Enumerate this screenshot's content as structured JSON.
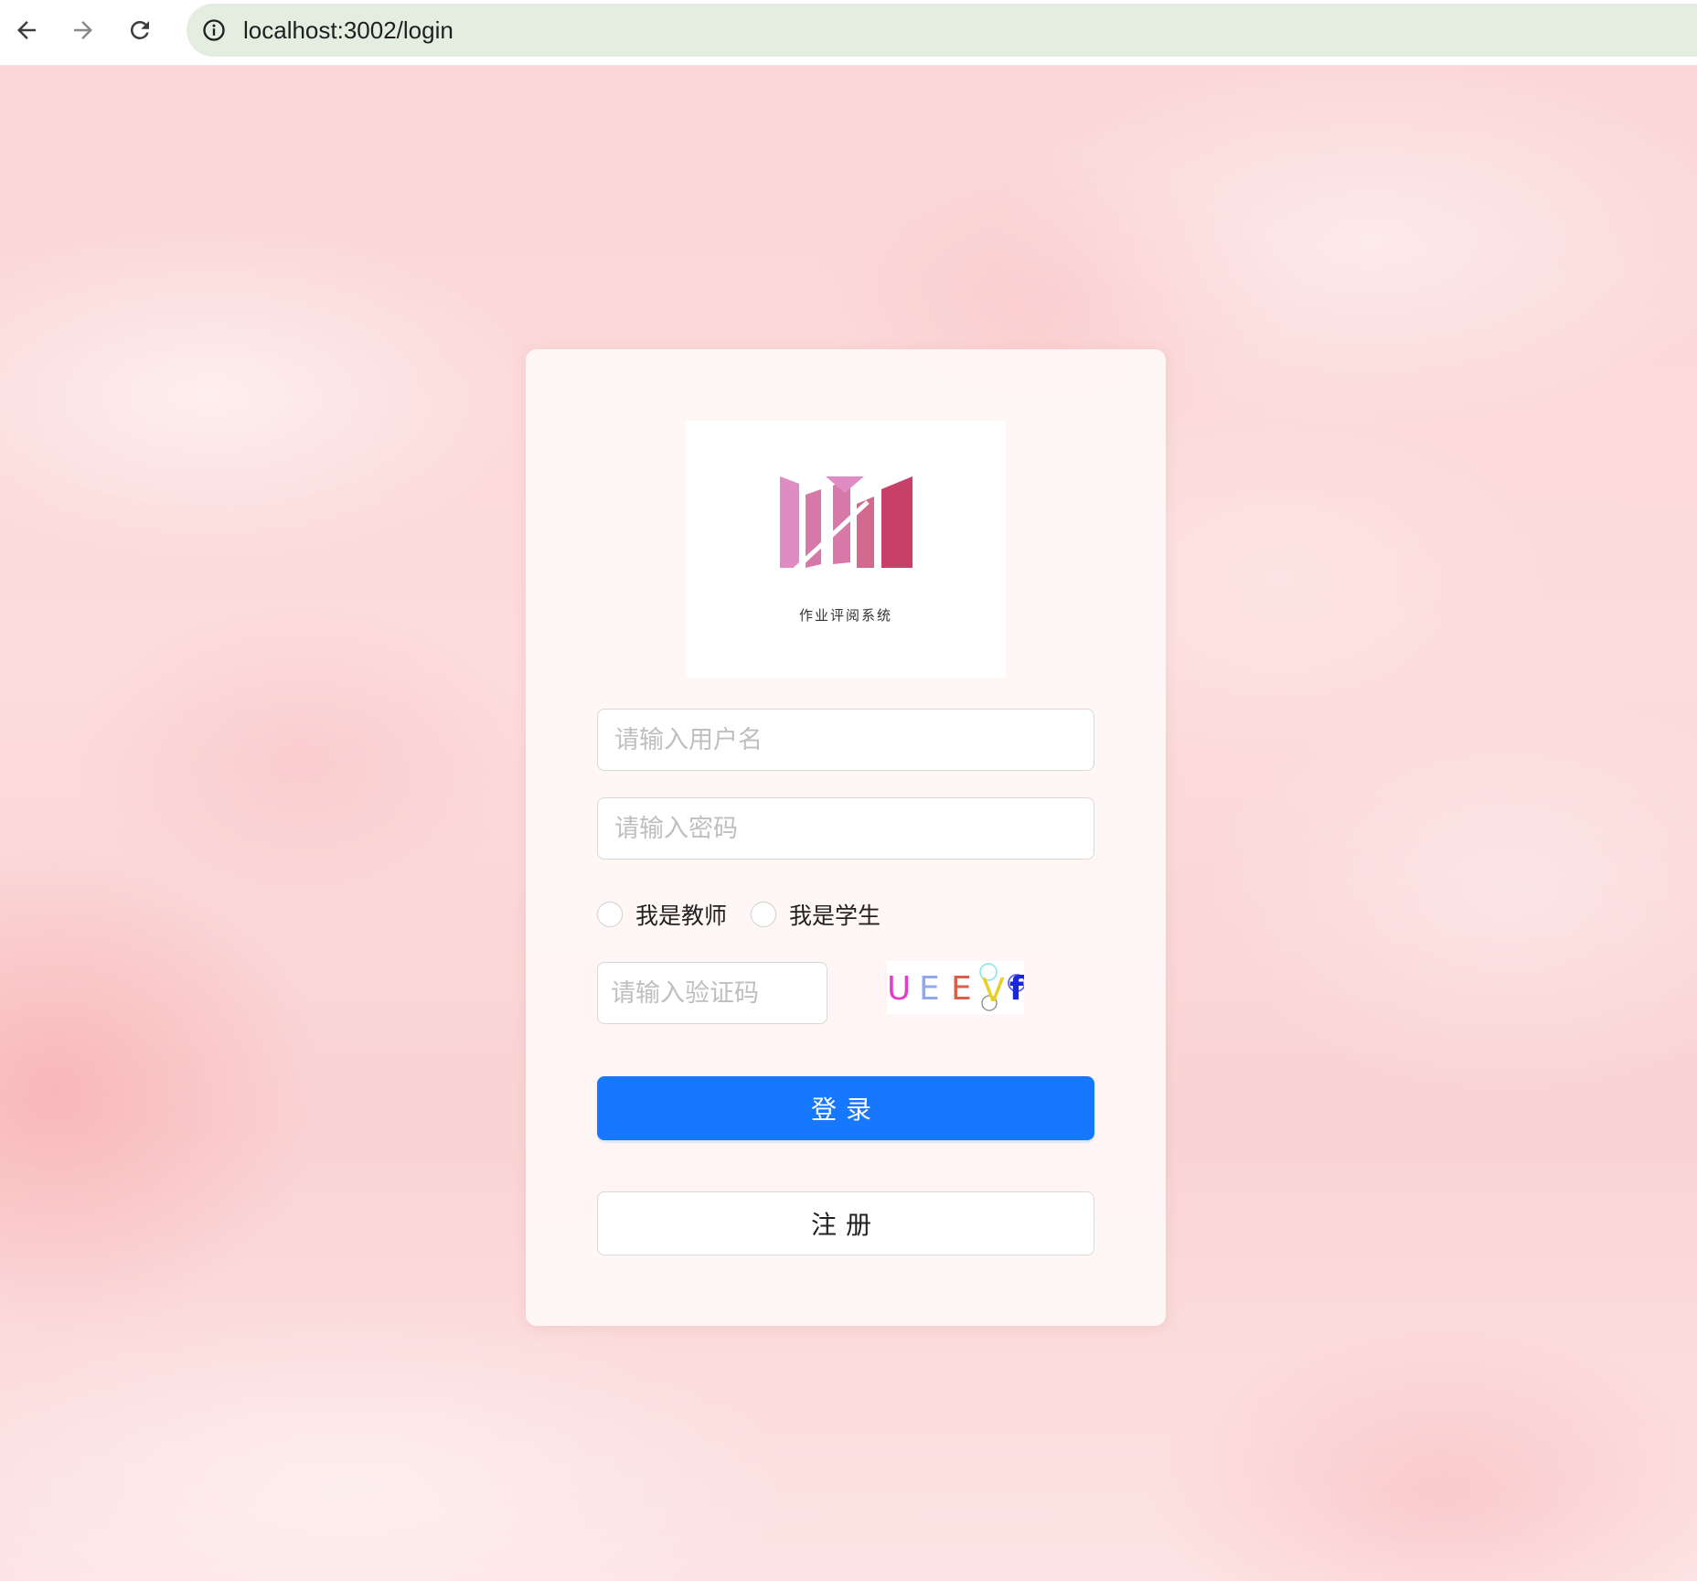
{
  "browser": {
    "url": "localhost:3002/login"
  },
  "logo": {
    "system_name": "作业评阅系统",
    "colors": [
      "#e08cc4",
      "#d679a8",
      "#d3698e",
      "#c84068"
    ]
  },
  "form": {
    "username_placeholder": "请输入用户名",
    "password_placeholder": "请输入密码",
    "roles": [
      {
        "label": "我是教师",
        "checked": false
      },
      {
        "label": "我是学生",
        "checked": false
      }
    ],
    "captcha_placeholder": "请输入验证码",
    "captcha": {
      "chars": [
        {
          "char": "U",
          "color": "#e040c8"
        },
        {
          "char": "E",
          "color": "#90a8f0"
        },
        {
          "char": "E",
          "color": "#d8604a"
        },
        {
          "char": "V",
          "color": "#e8d020"
        },
        {
          "char": "f",
          "color": "#1a28d8"
        }
      ]
    },
    "login_label": "登录",
    "register_label": "注册"
  },
  "colors": {
    "primary": "#1677ff",
    "background": "#fbd7d7"
  }
}
